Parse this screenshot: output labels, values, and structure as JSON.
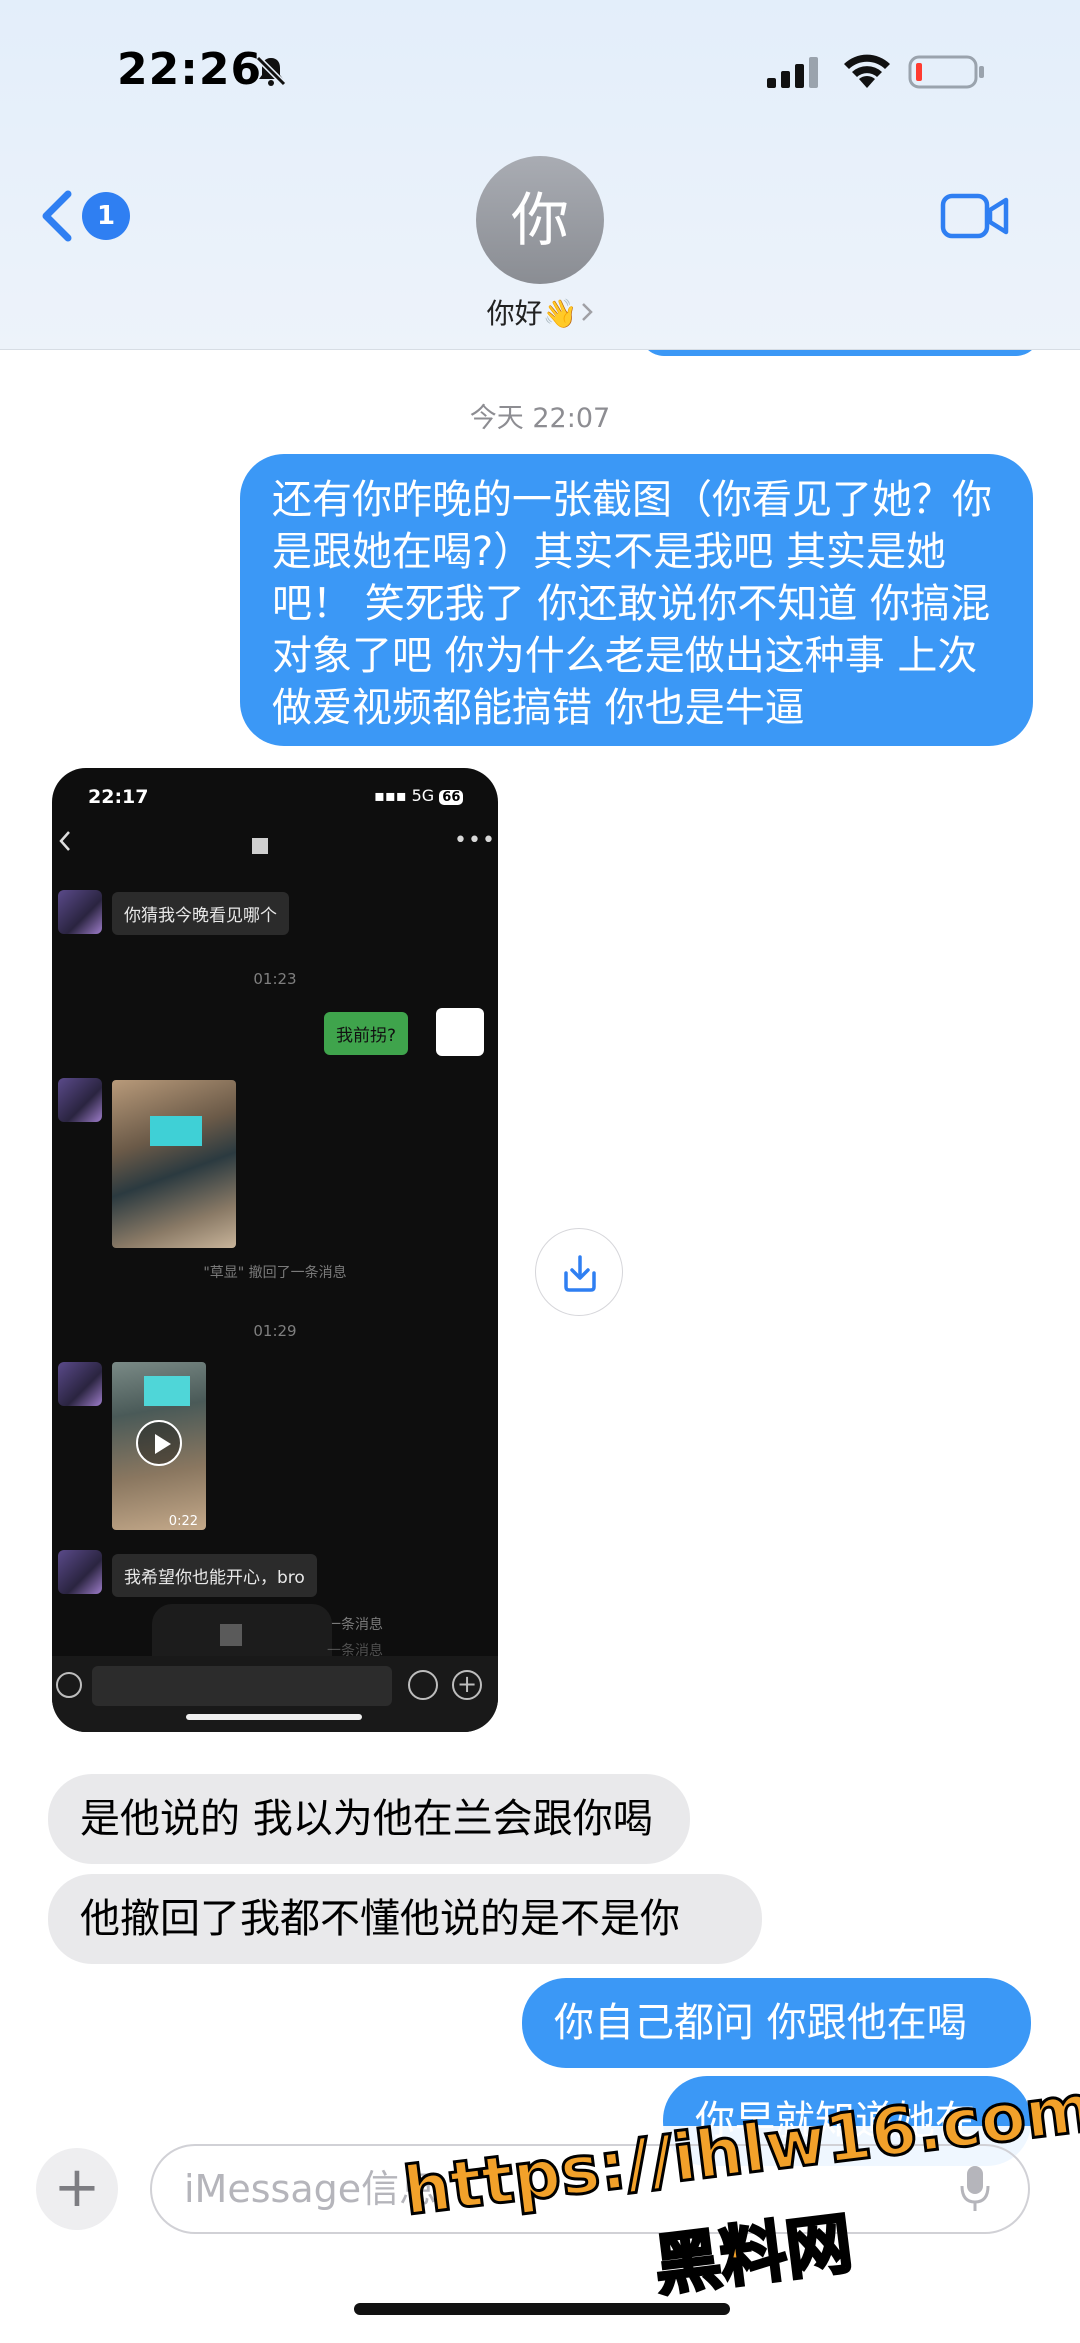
{
  "status_bar": {
    "time": "22:26"
  },
  "header": {
    "back_count": "1",
    "avatar_letter": "你",
    "contact_name": "你好👋"
  },
  "timestamp": "今天 22:07",
  "messages": {
    "out1": "还有你昨晚的一张截图（你看见了她？你是跟她在喝?）其实不是我吧 其实是她吧！ 笑死我了 你还敢说你不知道 你搞混对象了吧 你为什么老是做出这种事 上次做爱视频都能搞错 你也是牛逼",
    "in1": "是他说的 我以为他在兰会跟你喝",
    "in2": "他撤回了我都不懂他说的是不是你",
    "out2": "你自己都问 你跟他在喝",
    "out3": "你早就知道她在"
  },
  "screenshot": {
    "time": "22:17",
    "network": "5G",
    "battery": "66",
    "msg1": "你猜我今晚看见哪个",
    "ts1": "01:23",
    "msg_out": "我前拐?",
    "recall_note": "\"草显\" 撤回了一条消息",
    "ts2": "01:29",
    "video_duration": "0:22",
    "msg2": "我希望你也能开心，bro",
    "faded1": "一条消息",
    "faded2": "一条消息"
  },
  "input": {
    "placeholder": "iMessage信息"
  },
  "watermark": {
    "url": "https://ihlw16.com",
    "name": "黑料网"
  },
  "colors": {
    "outgoing": "#3b98f6",
    "incoming": "#e9e9eb",
    "accent": "#2f7ff2",
    "watermark": "#f2a12a"
  },
  "icons": [
    "bell-off-icon",
    "signal-icon",
    "wifi-icon",
    "battery-icon",
    "back-chevron-icon",
    "video-call-icon",
    "download-icon",
    "plus-icon",
    "microphone-icon",
    "play-icon"
  ]
}
